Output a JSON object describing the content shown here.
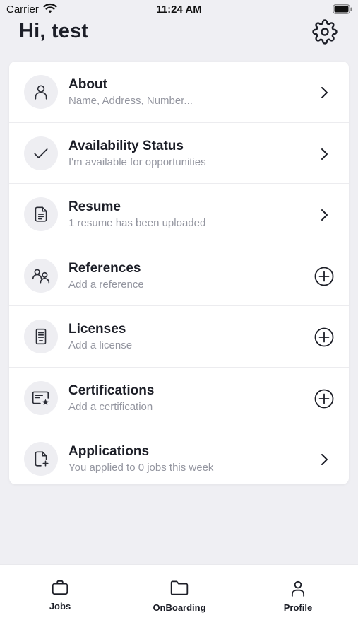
{
  "status_bar": {
    "carrier": "Carrier",
    "time": "11:24 AM"
  },
  "header": {
    "greeting": "Hi, test"
  },
  "profile_items": [
    {
      "title": "About",
      "subtitle": "Name, Address, Number...",
      "icon": "user-icon",
      "action": "chevron-right-icon"
    },
    {
      "title": "Availability Status",
      "subtitle": "I'm available for opportunities",
      "icon": "check-icon",
      "action": "chevron-right-icon"
    },
    {
      "title": "Resume",
      "subtitle": "1 resume has been uploaded",
      "icon": "document-icon",
      "action": "chevron-right-icon"
    },
    {
      "title": "References",
      "subtitle": "Add a reference",
      "icon": "people-icon",
      "action": "plus-circle-icon"
    },
    {
      "title": "Licenses",
      "subtitle": "Add a license",
      "icon": "license-icon",
      "action": "plus-circle-icon"
    },
    {
      "title": "Certifications",
      "subtitle": "Add a certification",
      "icon": "certificate-icon",
      "action": "plus-circle-icon"
    },
    {
      "title": "Applications",
      "subtitle": "You applied to 0 jobs this week",
      "icon": "file-plus-icon",
      "action": "chevron-right-icon"
    }
  ],
  "tabs": [
    {
      "label": "Jobs",
      "icon": "briefcase-icon"
    },
    {
      "label": "OnBoarding",
      "icon": "folder-icon"
    },
    {
      "label": "Profile",
      "icon": "person-icon"
    }
  ],
  "colors": {
    "background": "#efeff3",
    "card": "#ffffff",
    "text": "#1c1e27",
    "subtext": "#9496a0",
    "icon_bg": "#eeeef2"
  }
}
